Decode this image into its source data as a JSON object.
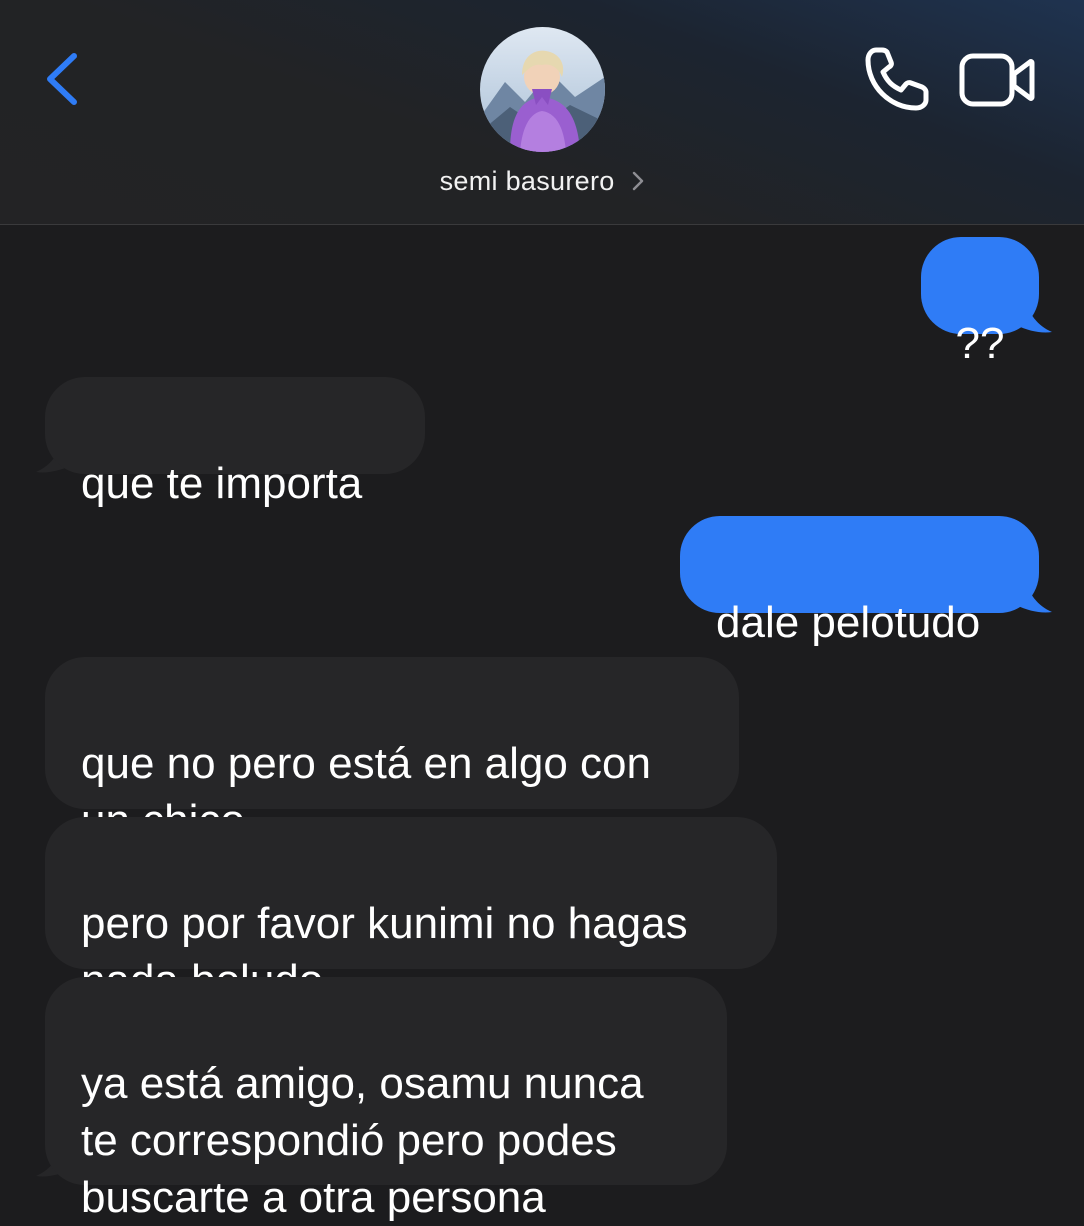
{
  "header": {
    "back_icon": "chevron-left-icon",
    "contact_name": "semi basurero",
    "call_icon": "phone-icon",
    "video_icon": "video-camera-icon",
    "accent_color": "#2f7cf6"
  },
  "messages": [
    {
      "direction": "sent",
      "text": "??"
    },
    {
      "direction": "received",
      "text": "que te importa"
    },
    {
      "direction": "sent",
      "text": "dale pelotudo"
    },
    {
      "direction": "received",
      "text": "que no pero está en algo con\nun chico"
    },
    {
      "direction": "received",
      "text": "pero por favor kunimi no hagas\nnada boludo"
    },
    {
      "direction": "received",
      "text": "ya está amigo, osamu nunca\nte correspondió pero podes\nbuscarte a otra persona"
    }
  ]
}
